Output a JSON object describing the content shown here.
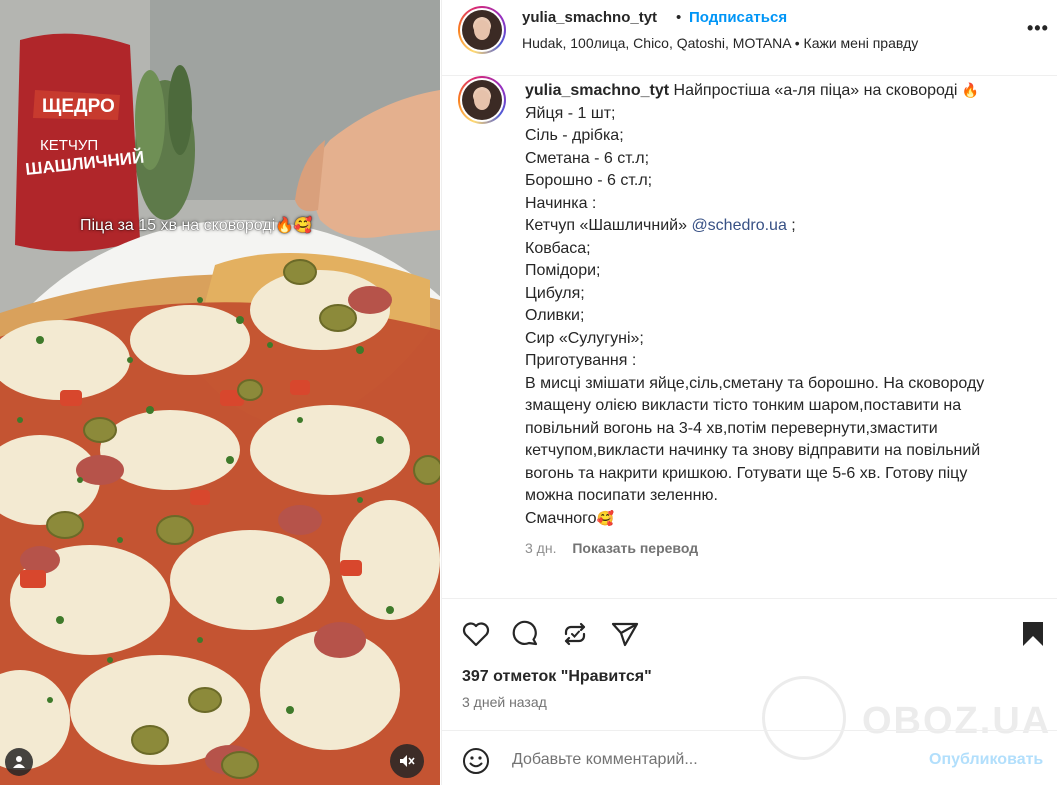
{
  "media": {
    "caption_text": "Піца за 15 хв на сковороді",
    "caption_emojis": "🔥🥰",
    "package_brand": "ЩЕДРО",
    "package_product": "КЕТЧУП",
    "package_flavor": "ШАШЛИЧНИЙ"
  },
  "header": {
    "username": "yulia_smachno_tyt",
    "separator": "•",
    "follow_label": "Подписаться",
    "audio": "Hudak, 100лица, Chico, Qatoshi, MOTANA • Кажи мені правду",
    "more_label": "•••"
  },
  "caption": {
    "username": "yulia_smachno_tyt",
    "title": "Найпростіша «а-ля піца» на сковороді",
    "title_emoji": "🔥",
    "lines": [
      "Яйця - 1 шт;",
      "Сіль - дрібка;",
      "Сметана - 6 ст.л;",
      "Борошно - 6 ст.л;",
      "Начинка :"
    ],
    "ketchup_prefix": "Кетчуп «Шашличний»",
    "mention": "@schedro.ua",
    "ketchup_suffix": ";",
    "lines2": [
      "Ковбаса;",
      "Помідори;",
      "Цибуля;",
      "Оливки;",
      "Сир «Сулугуні»;",
      "Приготування :"
    ],
    "paragraph": [
      "В мисці змішати яйце,сіль,сметану та борошно. На сковороду",
      "змащену олією викласти тісто тонким шаром,поставити на",
      "повільний вогонь на 3-4 хв,потім перевернути,змастити",
      "кетчупом,викласти начинку та знову відправити на повільний",
      "вогонь та накрити кришкою. Готувати ще 5-6 хв. Готову піцу",
      "можна посипати зеленню."
    ],
    "closing": "Смачного",
    "closing_emoji": "🥰",
    "time_ago": "3 дн.",
    "translate_label": "Показать перевод"
  },
  "stats": {
    "likes": "397 отметок \"Нравится\"",
    "posted": "3 дней назад"
  },
  "comment": {
    "placeholder": "Добавьте комментарий...",
    "publish_label": "Опубликовать"
  },
  "watermark": {
    "text": "OBOZ.UA"
  },
  "colors": {
    "accent": "#0095f6",
    "mention": "#385185",
    "publish_disabled": "#b2dffc",
    "muted": "#737373"
  },
  "icons": {
    "like": "heart-icon",
    "comment": "comment-icon",
    "repost": "repost-icon",
    "share": "send-icon",
    "save": "bookmark-icon",
    "emoji": "smiley-icon",
    "mute": "speaker-muted-icon",
    "tags": "person-icon"
  }
}
